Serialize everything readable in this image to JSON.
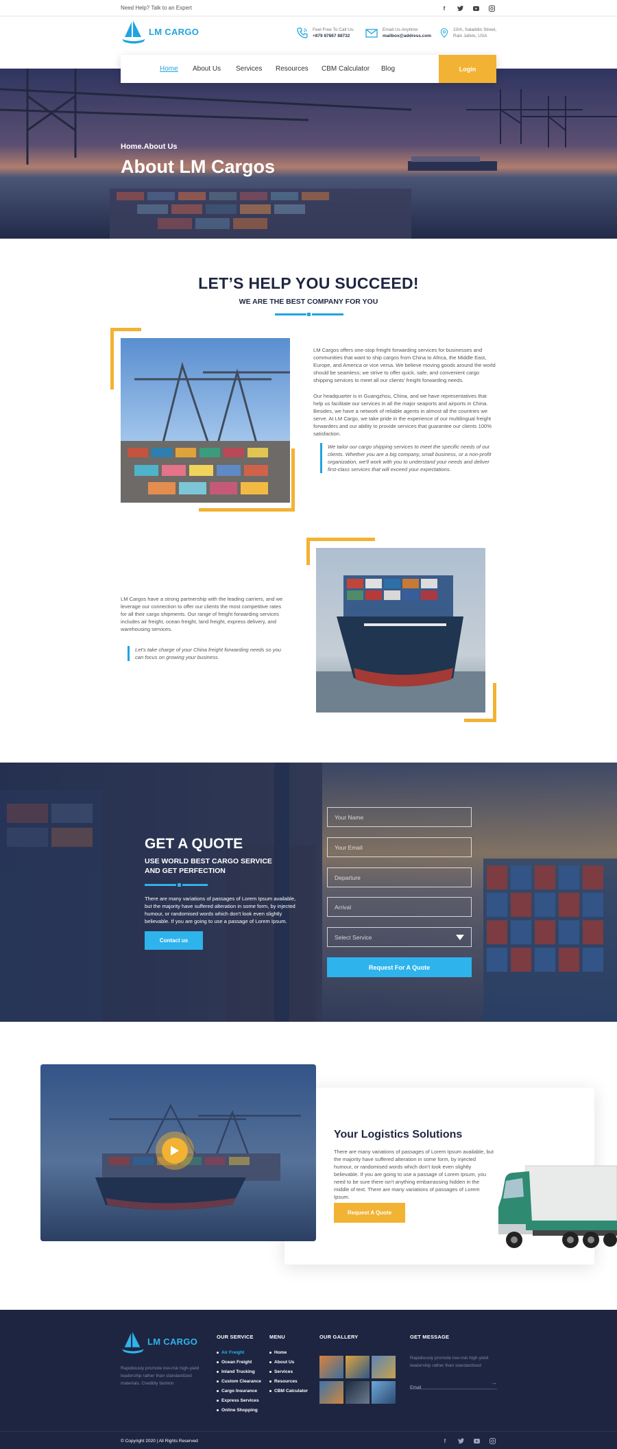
{
  "topbar": {
    "need_help": "Need Help? Talk to an Expert",
    "social": [
      "f",
      "t",
      "y",
      "ig"
    ]
  },
  "header": {
    "logo": "LM CARGO",
    "phone": {
      "label": "Feel Free To Call Us:",
      "value": "+879 87867 88732"
    },
    "email": {
      "label": "Email Us Anytime:",
      "value": "mailbox@address.com"
    },
    "address": {
      "line1": "10/A, Saladdin Street,",
      "line2": "Rain Jafelo, USA"
    }
  },
  "nav": {
    "items": [
      "Home",
      "About Us",
      "Services",
      "Resources",
      "CBM Calculator",
      "Blog"
    ],
    "login": "Login"
  },
  "hero": {
    "breadcrumb": "Home.About Us",
    "title": "About LM Cargos"
  },
  "intro": {
    "title": "LET’S HELP YOU SUCCEED!",
    "subtitle": "WE ARE THE BEST COMPANY FOR YOU",
    "para1": "LM Cargos offers one-stop freight forwarding services for businesses and communities that want to ship cargos from China to Africa, the Middle East, Europe, and America or vice versa. We believe moving goods around the world should be seamless; we strive to offer quick, safe, and convenient cargo shipping services to meet all our clients' freight forwarding needs.",
    "para2": "Our headquarter is in Guangzhou, China, and we have representatives that help us facilitate our services in all the major seaports and airports in China. Besides, we have a network of reliable agents in almost all the countries we serve. At LM Cargo, we take pride in the experience of our multilingual freight forwarders and our ability to provide services that guarantee our clients 100% satisfaction.",
    "quote1": "We tailor our cargo shipping services to meet the specific needs of our clients. Whether you are a big company, small business, or a non-profit organization, we'll work with you to understand your needs and deliver first-class services that will exceed your expectations.",
    "para3": "LM Cargos have a strong partnership with the leading carriers, and we leverage our connection to offer our clients the most competitive rates for all their cargo shipments. Our range of freight forwarding services includes air freight, ocean freight, land freight, express delivery, and warehousing services.",
    "quote2": "Let's take charge of your China freight forwarding needs so you can focus on growing your business."
  },
  "quote": {
    "title": "GET A QUOTE",
    "subtitle_line1": "USE WORLD BEST CARGO SERVICE",
    "subtitle_line2": "AND GET PERFECTION",
    "text": "There are many variations of passages of Lorem Ipsum available, but the majority have suffered alteration in some form, by injected humour, or randomised words which don't look even slightly believable. If you are going to use a passage of Lorem Ipsum.",
    "contact_button": "Contact us",
    "fields": [
      "Your Name",
      "Your Email",
      "Departure",
      "Arrival"
    ],
    "select": "Select Service",
    "submit": "Request For A Quote"
  },
  "solutions": {
    "title": "Your Logistics Solutions",
    "text": "There are many variations of passages of Lorem Ipsum available, but the majority have suffered alteration in some form, by injected humour, or randomised words which don't look even slightly believable. If you are going to use a passage of Lorem Ipsum, you need to be sure there isn't anything embarrassing hidden in the middle of text. There are many variations of passages of Lorem Ipsum.",
    "button": "Request A Quote"
  },
  "footer": {
    "logo": "LM CARGO",
    "about": "Rapidiously promote low-risk high-yield leadership rather than standardized materials. Credibly fashion",
    "service_title": "OUR SERVICE",
    "services": [
      "Air Freight",
      "Ocean Freight",
      "Inland Trucking",
      "Custom Clearance",
      "Cargo Insurance",
      "Express Services",
      "Online Shopping"
    ],
    "menu_title": "MENU",
    "menu": [
      "Home",
      "About Us",
      "Services",
      "Resources",
      "CBM Calculator"
    ],
    "gallery_title": "OUR GALLERY",
    "message_title": "GET MESSAGE",
    "message_text": "Rapidiously promote low-risk high-yield leadership rather than standardized",
    "email_placeholder": "Email",
    "copyright": "© Copyright 2020 | All Rights Reserved"
  },
  "colors": {
    "accent": "#1fa4e0",
    "gold": "#f2b233",
    "navy": "#1d2541"
  }
}
